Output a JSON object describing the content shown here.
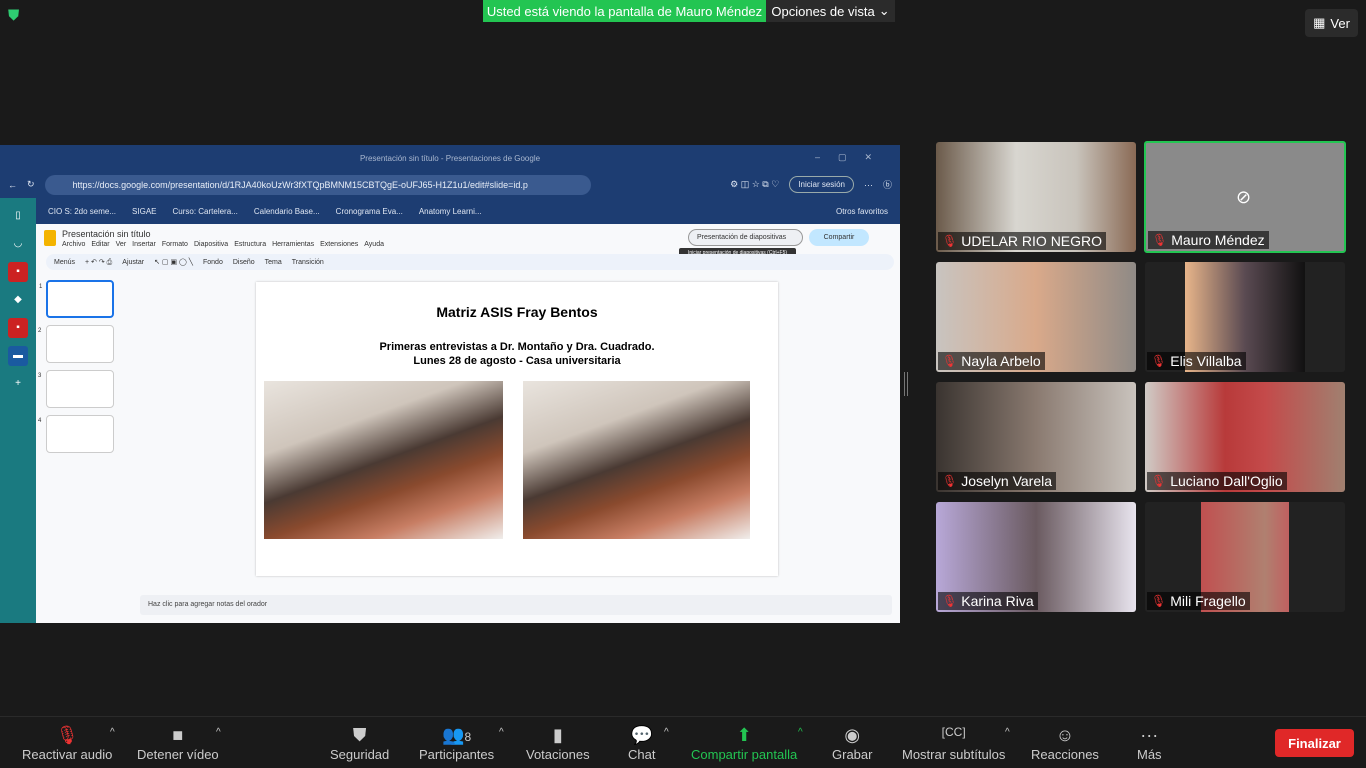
{
  "zoom": {
    "banner": "Usted está viendo la pantalla de Mauro Méndez",
    "view_options": "Opciones de vista",
    "view_button": "Ver"
  },
  "browser": {
    "window_title": "Presentación sin título - Presentaciones de Google",
    "url": "https://docs.google.com/presentation/d/1RJA40koUzWr3fXTQpBMNM15CBTQgE-oUFJ65-H1Z1u1/edit#slide=id.p",
    "login": "Iniciar sesión",
    "bookmarks": [
      "CIO S: 2do seme...",
      "SIGAE",
      "Curso: Cartelera...",
      "Calendario Base...",
      "Cronograma Eva...",
      "Anatomy Learni..."
    ],
    "other_favorites": "Otros favoritos"
  },
  "slides": {
    "doc_title": "Presentación sin título",
    "menu": [
      "Archivo",
      "Editar",
      "Ver",
      "Insertar",
      "Formato",
      "Diapositiva",
      "Estructura",
      "Herramientas",
      "Extensiones",
      "Ayuda"
    ],
    "present_button": "Presentación de diapositivas",
    "share_button": "Compartir",
    "tooltip": "Iniciar presentación de diapositivas (Ctrl+F5)",
    "toolbar": [
      "Menús",
      "Ajustar",
      "Fondo",
      "Diseño",
      "Tema",
      "Transición"
    ],
    "thumbnails": [
      "1",
      "2",
      "3",
      "4"
    ],
    "slide": {
      "title": "Matriz ASIS Fray Bentos",
      "subtitle_line1": "Primeras entrevistas a Dr. Montaño y Dra. Cuadrado.",
      "subtitle_line2": "Lunes 28 de agosto - Casa universitaria"
    },
    "notes_placeholder": "Haz clic para agregar notas del orador"
  },
  "participants": [
    {
      "name": "UDELAR RIO NEGRO",
      "muted": true
    },
    {
      "name": "Mauro Méndez",
      "muted": true,
      "video_off": true,
      "active": true
    },
    {
      "name": "Nayla Arbelo",
      "muted": true
    },
    {
      "name": "Elis Villalba",
      "muted": true
    },
    {
      "name": "Joselyn Varela",
      "muted": true
    },
    {
      "name": "Luciano Dall'Oglio",
      "muted": true
    },
    {
      "name": "Karina Riva",
      "muted": true
    },
    {
      "name": "Mili Fragello",
      "muted": true
    }
  ],
  "toolbar": {
    "audio": "Reactivar audio",
    "video": "Detener vídeo",
    "security": "Seguridad",
    "participants": "Participantes",
    "participants_count": "8",
    "polls": "Votaciones",
    "chat": "Chat",
    "share": "Compartir pantalla",
    "record": "Grabar",
    "captions": "Mostrar subtítulos",
    "reactions": "Reacciones",
    "more": "Más",
    "end": "Finalizar"
  },
  "colors": {
    "share_green": "#23c552",
    "end_red": "#e02828",
    "browser_blue": "#1d3d72"
  }
}
